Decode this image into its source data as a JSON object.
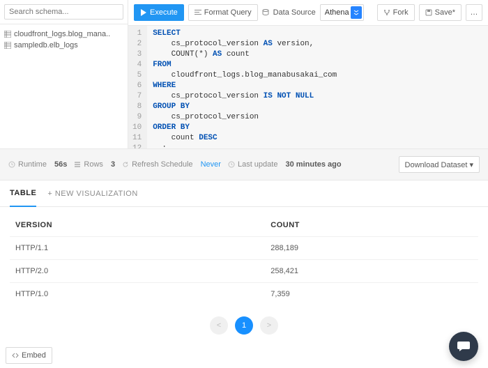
{
  "sidebar": {
    "search_placeholder": "Search schema...",
    "tables": [
      "cloudfront_logs.blog_mana..",
      "sampledb.elb_logs"
    ]
  },
  "toolbar": {
    "execute": "Execute",
    "format": "Format Query",
    "datasource_label": "Data Source",
    "datasource_value": "Athena",
    "fork": "Fork",
    "save": "Save*",
    "more": "…"
  },
  "query": {
    "lines": [
      [
        [
          "kw",
          "SELECT"
        ]
      ],
      [
        [
          "txt",
          "    cs_protocol_version "
        ],
        [
          "kw",
          "AS"
        ],
        [
          "txt",
          " version,"
        ]
      ],
      [
        [
          "txt",
          "    COUNT(*) "
        ],
        [
          "kw",
          "AS"
        ],
        [
          "txt",
          " count"
        ]
      ],
      [
        [
          "kw",
          "FROM"
        ]
      ],
      [
        [
          "txt",
          "    cloudfront_logs.blog_manabusakai_com"
        ]
      ],
      [
        [
          "kw",
          "WHERE"
        ]
      ],
      [
        [
          "txt",
          "    cs_protocol_version "
        ],
        [
          "kw",
          "IS NOT NULL"
        ]
      ],
      [
        [
          "kw",
          "GROUP BY"
        ]
      ],
      [
        [
          "txt",
          "    cs_protocol_version"
        ]
      ],
      [
        [
          "kw",
          "ORDER BY"
        ]
      ],
      [
        [
          "txt",
          "    count "
        ],
        [
          "kw",
          "DESC"
        ]
      ],
      [
        [
          "txt",
          "  ;"
        ]
      ],
      [
        [
          "txt",
          ""
        ]
      ]
    ]
  },
  "status": {
    "runtime_label": "Runtime",
    "runtime_value": "56s",
    "rows_label": "Rows",
    "rows_value": "3",
    "refresh_label": "Refresh Schedule",
    "refresh_value": "Never",
    "lastupdate_label": "Last update",
    "lastupdate_value": "30 minutes ago",
    "download": "Download Dataset ▾"
  },
  "tabs": {
    "table": "TABLE",
    "newviz": "+ NEW VISUALIZATION"
  },
  "results": {
    "columns": [
      "VERSION",
      "COUNT"
    ],
    "rows": [
      [
        "HTTP/1.1",
        "288,189"
      ],
      [
        "HTTP/2.0",
        "258,421"
      ],
      [
        "HTTP/1.0",
        "7,359"
      ]
    ]
  },
  "pager": {
    "prev": "<",
    "page": "1",
    "next": ">"
  },
  "footer": {
    "embed": "Embed"
  }
}
